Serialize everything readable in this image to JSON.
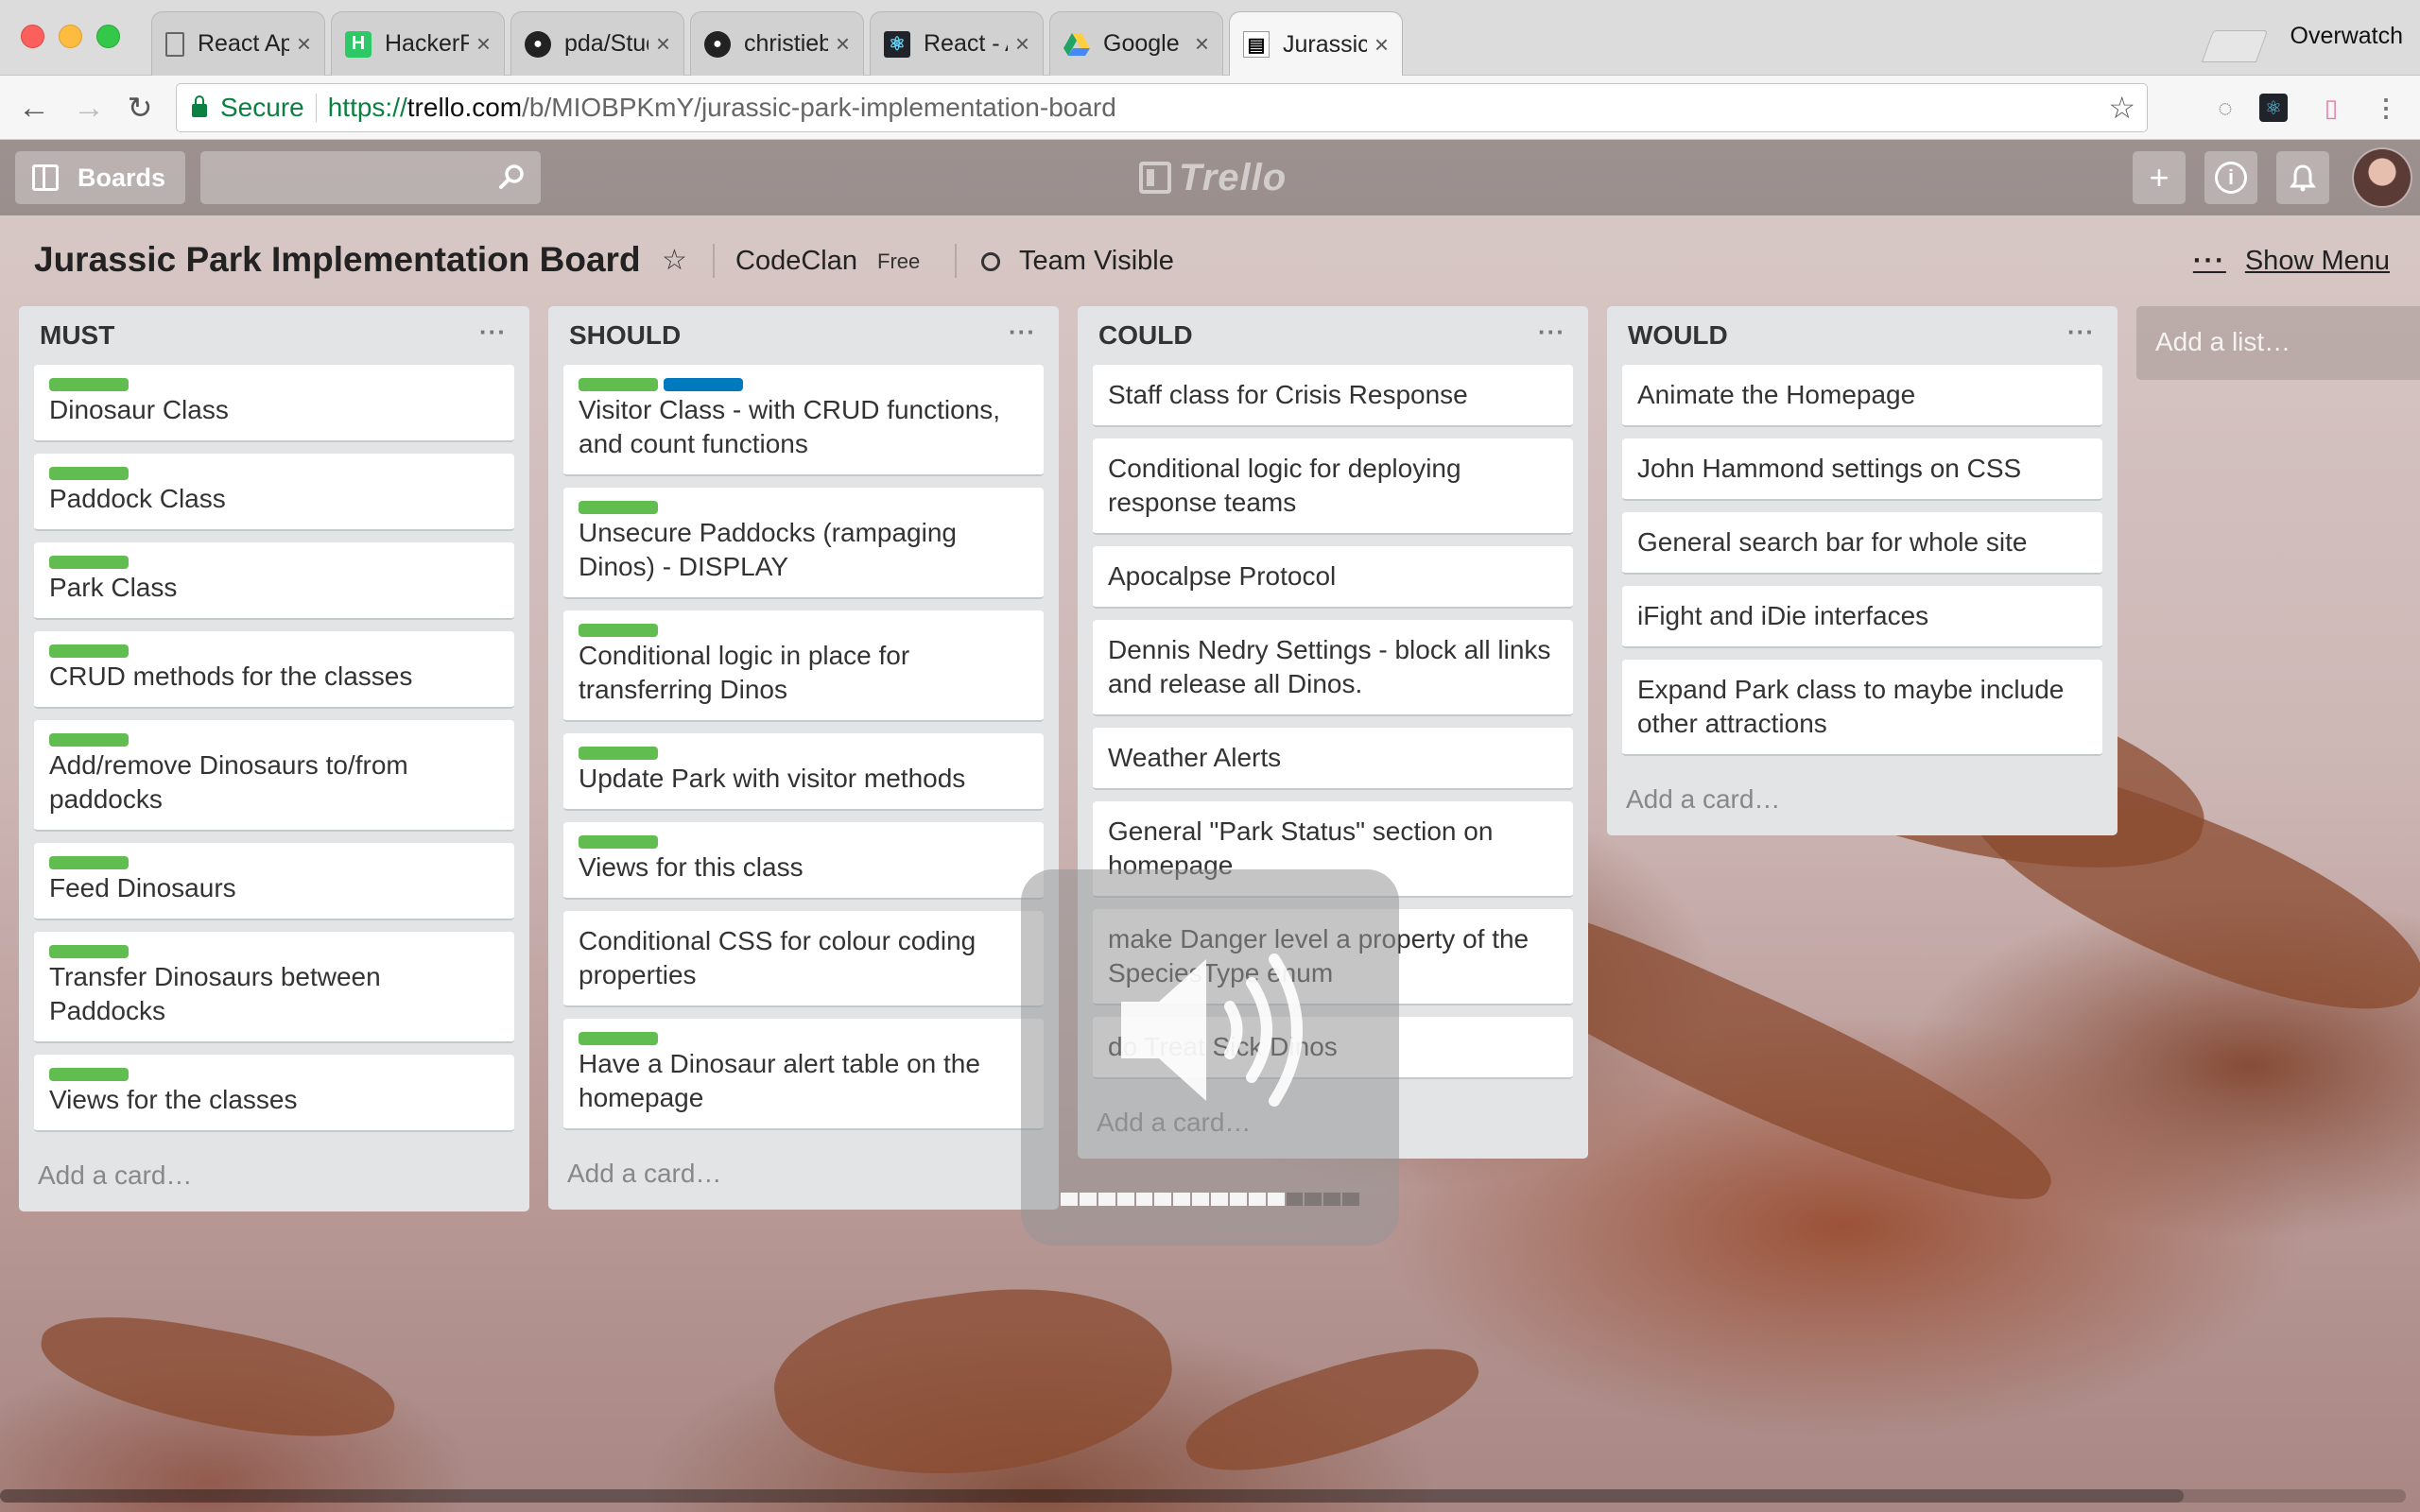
{
  "browser": {
    "tabs": [
      {
        "label": "React App",
        "icon": "page-icon"
      },
      {
        "label": "HackerRank | Tech",
        "icon": "hackerrank-icon"
      },
      {
        "label": "pda/Student Check",
        "icon": "github-icon"
      },
      {
        "label": "christiebelle/PDA",
        "icon": "github-icon"
      },
      {
        "label": "React - A JavaScr",
        "icon": "react-icon"
      },
      {
        "label": "Google Drive - Cl",
        "icon": "google-drive-icon"
      },
      {
        "label": "Jurassic Park Imp",
        "icon": "trello-icon"
      }
    ],
    "close_glyph": "×",
    "profile": "Overwatch",
    "secure_label": "Secure",
    "url_scheme": "https://",
    "url_host": "trello.com",
    "url_path": "/b/MIOBPKmY/jurassic-park-implementation-board"
  },
  "header": {
    "boards_label": "Boards",
    "logo_text": "Trello",
    "plus_glyph": "+",
    "info_glyph": "i"
  },
  "board": {
    "title": "Jurassic Park Implementation Board",
    "team": "CodeClan",
    "team_plan": "Free",
    "visibility": "Team Visible",
    "show_menu": "Show Menu",
    "menu_dots": "···"
  },
  "lists": [
    {
      "title": "MUST",
      "cards": [
        {
          "text": "Dinosaur Class",
          "labels": [
            "green"
          ]
        },
        {
          "text": "Paddock Class",
          "labels": [
            "green"
          ]
        },
        {
          "text": "Park Class",
          "labels": [
            "green"
          ]
        },
        {
          "text": "CRUD methods for the classes",
          "labels": [
            "green"
          ]
        },
        {
          "text": "Add/remove Dinosaurs to/from paddocks",
          "labels": [
            "green"
          ]
        },
        {
          "text": "Feed Dinosaurs",
          "labels": [
            "green"
          ]
        },
        {
          "text": "Transfer Dinosaurs between Paddocks",
          "labels": [
            "green"
          ]
        },
        {
          "text": "Views for the classes",
          "labels": [
            "green"
          ]
        }
      ],
      "add_card": "Add a card…"
    },
    {
      "title": "SHOULD",
      "cards": [
        {
          "text": "Visitor Class - with CRUD functions, and count functions",
          "labels": [
            "green",
            "blue"
          ]
        },
        {
          "text": "Unsecure Paddocks (rampaging Dinos) - DISPLAY",
          "labels": [
            "green"
          ]
        },
        {
          "text": "Conditional logic in place for transferring Dinos",
          "labels": [
            "green"
          ]
        },
        {
          "text": "Update Park with visitor methods",
          "labels": [
            "green"
          ]
        },
        {
          "text": "Views for this class",
          "labels": [
            "green"
          ]
        },
        {
          "text": "Conditional CSS for colour coding properties",
          "labels": []
        },
        {
          "text": "Have a Dinosaur alert table on the homepage",
          "labels": [
            "green"
          ]
        }
      ],
      "add_card": "Add a card…"
    },
    {
      "title": "COULD",
      "cards": [
        {
          "text": "Staff class for Crisis Response",
          "labels": []
        },
        {
          "text": "Conditional logic for deploying response teams",
          "labels": []
        },
        {
          "text": "Apocalpse Protocol",
          "labels": []
        },
        {
          "text": "Dennis Nedry Settings - block all links and release all Dinos.",
          "labels": []
        },
        {
          "text": "Weather Alerts",
          "labels": []
        },
        {
          "text": "General \"Park Status\" section on homepage",
          "labels": []
        },
        {
          "text": "make Danger level a property of the SpeciesType enum",
          "labels": []
        },
        {
          "text": "do Treat Sick Dinos",
          "labels": []
        }
      ],
      "add_card": "Add a card…"
    },
    {
      "title": "WOULD",
      "cards": [
        {
          "text": "Animate the Homepage",
          "labels": []
        },
        {
          "text": "John Hammond settings on CSS",
          "labels": []
        },
        {
          "text": "General search bar for whole site",
          "labels": []
        },
        {
          "text": "iFight and iDie interfaces",
          "labels": []
        },
        {
          "text": "Expand Park class to maybe include other attractions",
          "labels": []
        }
      ],
      "add_card": "Add a card…"
    }
  ],
  "add_list": "Add a list…",
  "volume_hud": {
    "level": 0.75,
    "segments": 16
  },
  "colors": {
    "label_green": "#61bd4f",
    "label_blue": "#0079bf",
    "list_bg": "#e2e4e6"
  }
}
